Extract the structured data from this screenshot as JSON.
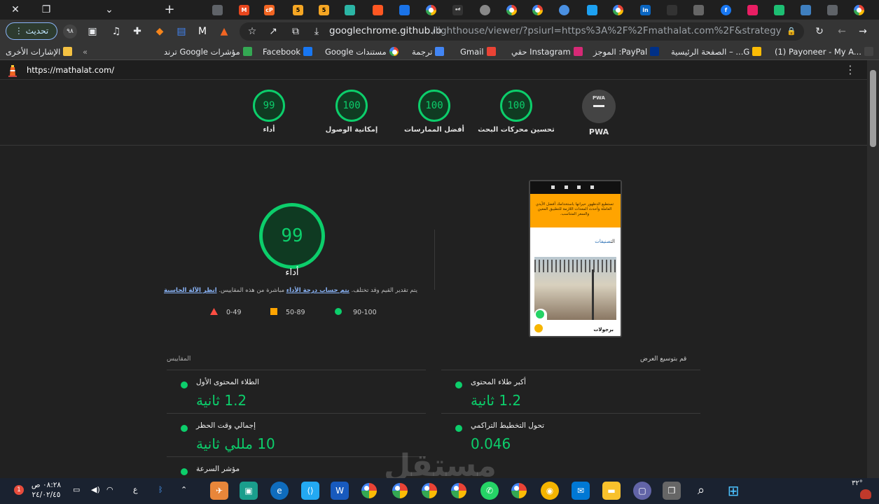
{
  "tabbar": {
    "controls": [
      "✕",
      "❐",
      "⌄"
    ],
    "new_tab": "+"
  },
  "toolbar": {
    "update_label": "تحديث",
    "url_host": "googlechrome.github.io",
    "url_rest": "/lighthouse/viewer/?psiurl=https%3A%2F%2Fmathalat.com%2F&strategy=mobil..."
  },
  "bookmarks": {
    "other": "الإشارات الأخرى",
    "items": [
      "مؤشرات Google ترند",
      "Facebook",
      "مستندات Google",
      "ترجمة",
      "Gmail",
      "Instagram حقي",
      "PayPal: الموجز",
      "G... – الصفحة الرئيسية",
      "(1) Payoneer - My A..."
    ]
  },
  "lighthouse": {
    "url": "https://mathalat.com/",
    "categories": [
      {
        "score": "99",
        "label": "أداء"
      },
      {
        "score": "100",
        "label": "إمكانية الوصول"
      },
      {
        "score": "100",
        "label": "أفضل الممارسات"
      },
      {
        "score": "100",
        "label": "تحسين محركات البحث"
      }
    ],
    "pwa_label": "PWA",
    "pwa_badge": "PWA",
    "performance": {
      "score": "99",
      "title": "أداء",
      "note_prefix": "يتم تقدير القيم وقد تختلف.",
      "note_link1": "يتم حساب درجة الأداء",
      "note_mid": "مباشرة من هذه المقاييس.",
      "note_link2": "انظر الآلة الحاسبة"
    },
    "legend": [
      {
        "range": "0-49",
        "color": "#ff4e42"
      },
      {
        "range": "50-89",
        "color": "#ffa400"
      },
      {
        "range": "90-100",
        "color": "#0cce6b"
      }
    ],
    "screenshot": {
      "banner_text": "تستطيع الدظهور حيرانها باستخدامك أفضل الأيدي العاملة وأحدث المعدات اللازمة للتطبيق المعين والسعر المتناسب.",
      "category_prefix": "الت",
      "category_highlight": "صنيفات",
      "caption": "برجولات"
    },
    "metrics_header": "المقاييس",
    "expand_view": "قم بتوسيع العرض",
    "metrics": [
      {
        "label": "الطلاء المحتوى الأول",
        "value": "1.2 ثانية"
      },
      {
        "label": "أكبر طلاء المحتوى",
        "value": "1.2 ثانية"
      },
      {
        "label": "إجمالي وقت الحظر",
        "value": "10 مللي ثانية"
      },
      {
        "label": "تحول التخطيط التراكمي",
        "value": "0.046"
      },
      {
        "label": "مؤشر السرعة",
        "value": ""
      }
    ]
  },
  "watermark": "مستقل",
  "taskbar": {
    "time": "٠٨:٢٨ ص",
    "date": "٢٤/٠٢/٤٥",
    "temp": "٣٢°",
    "notif": "1",
    "lang": "ع"
  }
}
